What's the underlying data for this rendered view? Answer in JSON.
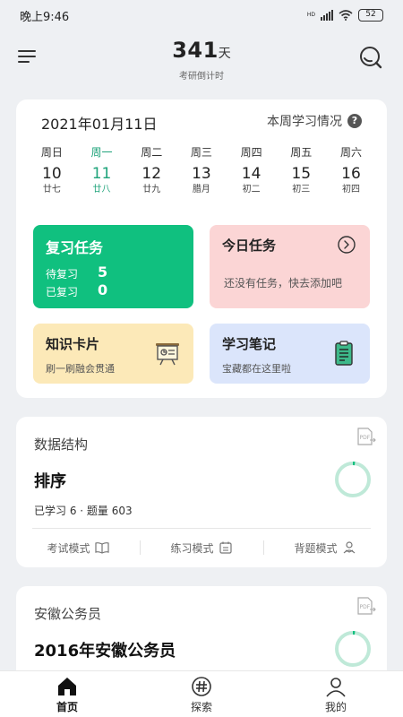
{
  "status_bar": {
    "time": "晚上9:46",
    "network": "HD",
    "battery": "52"
  },
  "header": {
    "count": "341",
    "unit": "天",
    "label": "考研倒计时"
  },
  "calendar": {
    "date": "2021年01月11日",
    "week_link": "本周学习情况",
    "help": "?",
    "days": [
      {
        "name": "周日",
        "num": "10",
        "lunar": "廿七",
        "active": false
      },
      {
        "name": "周一",
        "num": "11",
        "lunar": "廿八",
        "active": true
      },
      {
        "name": "周二",
        "num": "12",
        "lunar": "廿九",
        "active": false
      },
      {
        "name": "周三",
        "num": "13",
        "lunar": "腊月",
        "active": false
      },
      {
        "name": "周四",
        "num": "14",
        "lunar": "初二",
        "active": false
      },
      {
        "name": "周五",
        "num": "15",
        "lunar": "初三",
        "active": false
      },
      {
        "name": "周六",
        "num": "16",
        "lunar": "初四",
        "active": false
      }
    ]
  },
  "tiles": {
    "review": {
      "title": "复习任务",
      "pending_label": "待复习",
      "pending_count": "5",
      "done_label": "已复习",
      "done_count": "0"
    },
    "today": {
      "title": "今日任务",
      "subtitle": "还没有任务，快去添加吧"
    },
    "cards": {
      "title": "知识卡片",
      "subtitle": "刷一刷融会贯通"
    },
    "notes": {
      "title": "学习笔记",
      "subtitle": "宝藏都在这里啦"
    }
  },
  "courses": [
    {
      "category": "数据结构",
      "name": "排序",
      "stats": "已学习 6 · 题量 603",
      "progress": 0.02,
      "modes": [
        "考试模式",
        "练习模式",
        "背题模式"
      ]
    },
    {
      "category": "安徽公务员",
      "name": "2016年安徽公务员",
      "progress": 0.02
    }
  ],
  "nav": [
    {
      "label": "首页",
      "icon": "home-icon",
      "active": true
    },
    {
      "label": "探索",
      "icon": "explore-hash-icon",
      "active": false
    },
    {
      "label": "我的",
      "icon": "profile-icon",
      "active": false
    }
  ],
  "colors": {
    "accent": "#10c07f",
    "active_day": "#1ea37a",
    "ring": "#bfe9d8",
    "today_tile": "#fbd5d5",
    "cards_tile": "#fce9b8",
    "notes_tile": "#dbe5fb"
  }
}
